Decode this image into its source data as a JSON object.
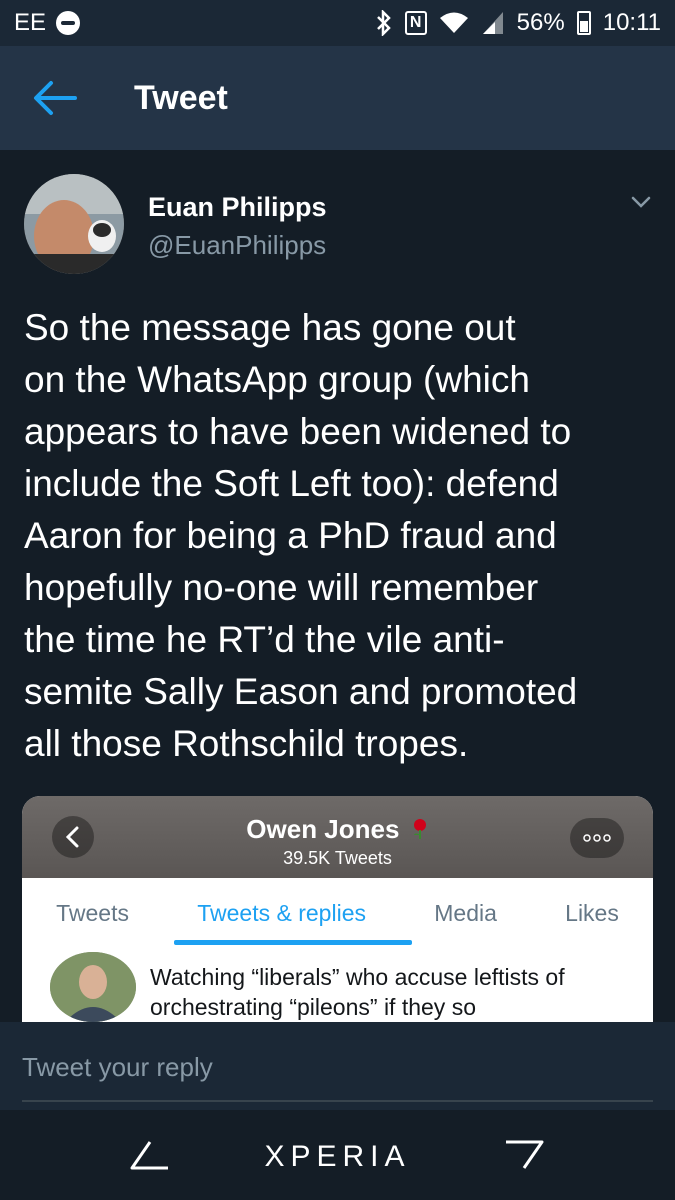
{
  "status_bar": {
    "carrier": "EE",
    "battery_percent": "56%",
    "time": "10:11"
  },
  "app_bar": {
    "title": "Tweet"
  },
  "tweet": {
    "author_name": "Euan Philipps",
    "author_handle": "@EuanPhilipps",
    "text": "So the message has gone out\non the WhatsApp group (which\nappears to have been widened to\ninclude the Soft Left too): defend\nAaron for being a PhD fraud and\nhopefully no-one will remember\nthe time he RT’d the vile anti-\nsemite Sally Eason and promoted\nall those Rothschild tropes."
  },
  "media": {
    "profile_name": "Owen Jones",
    "tweet_count": "39.5K Tweets",
    "tabs": [
      {
        "label": "Tweets",
        "active": false
      },
      {
        "label": "Tweets & replies",
        "active": true
      },
      {
        "label": "Media",
        "active": false
      },
      {
        "label": "Likes",
        "active": false
      }
    ],
    "row_text": "Watching “liberals” who accuse leftists of orchestrating “pileons” if they so"
  },
  "reply": {
    "placeholder": "Tweet your reply"
  },
  "nav_bar": {
    "brand": "XPERIA"
  },
  "colors": {
    "background": "#141d26",
    "app_bar": "#243447",
    "accent": "#1da1f2",
    "secondary_text": "#8899a6"
  }
}
